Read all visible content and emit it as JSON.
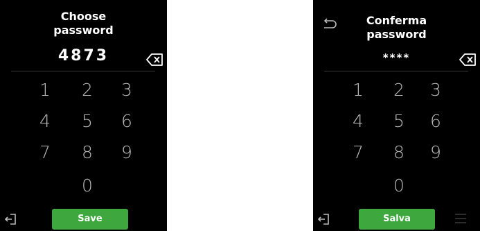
{
  "left_screen": {
    "title_line1": "Choose",
    "title_line2": "password",
    "pin": "4873",
    "keys": [
      "1",
      "2",
      "3",
      "4",
      "5",
      "6",
      "7",
      "8",
      "9",
      "0"
    ],
    "save_label": "Save"
  },
  "right_screen": {
    "title_line1": "Conferma",
    "title_line2": "password",
    "pin": "****",
    "keys": [
      "1",
      "2",
      "3",
      "4",
      "5",
      "6",
      "7",
      "8",
      "9",
      "0"
    ],
    "save_label": "Salva"
  },
  "colors": {
    "accent_green": "#3ea83e",
    "background": "#000000",
    "key_text": "#bcbcbc"
  },
  "icons": [
    "backspace-icon",
    "logout-icon",
    "back-arrow-icon",
    "menu-icon"
  ]
}
